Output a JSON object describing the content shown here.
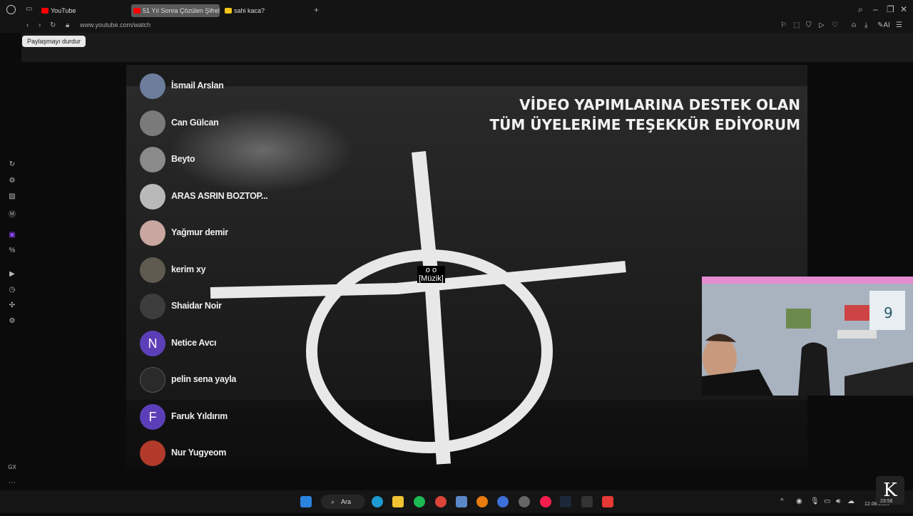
{
  "browser": {
    "tabs": [
      {
        "label": "YouTube",
        "favicon_color": "#ff0000"
      },
      {
        "label": "51 Yıl Sonra Çözülen Şifrel",
        "favicon_color": "#ff0000"
      },
      {
        "label": "sahi kaca?",
        "favicon_color": "#f5c518"
      }
    ],
    "url": "www.youtube.com/watch",
    "tooltip": "Paylaşmayı durdur",
    "sidebar_bottom_label": "GX"
  },
  "video": {
    "title_line1": "VİDEO YAPIMLARINA DESTEK OLAN",
    "title_line2": "TÜM ÜYELERİME TEŞEKKÜR EDİYORUM",
    "caption_symbols": "o o",
    "caption_text": "[Müzik]",
    "members": [
      {
        "name": "İsmail Arslan",
        "avatar": "photo"
      },
      {
        "name": "Can Gülcan",
        "avatar": "photo"
      },
      {
        "name": "Beyto",
        "avatar": "photo"
      },
      {
        "name": "ARAS ASRIN BOZTOP...",
        "avatar": "photo"
      },
      {
        "name": "Yağmur demir",
        "avatar": "photo"
      },
      {
        "name": "kerim xy",
        "avatar": "photo"
      },
      {
        "name": "Shaidar Noir",
        "avatar": "photo"
      },
      {
        "name": "Netice Avcı",
        "avatar": "letter",
        "letter": "N"
      },
      {
        "name": "pelin sena yayla",
        "avatar": "dark"
      },
      {
        "name": "Faruk Yıldırım",
        "avatar": "letter",
        "letter": "F"
      },
      {
        "name": "Nur Yugyeom",
        "avatar": "photo"
      }
    ]
  },
  "taskbar": {
    "search_label": "Ara",
    "date": "12.08.2026",
    "time": "23:56"
  }
}
